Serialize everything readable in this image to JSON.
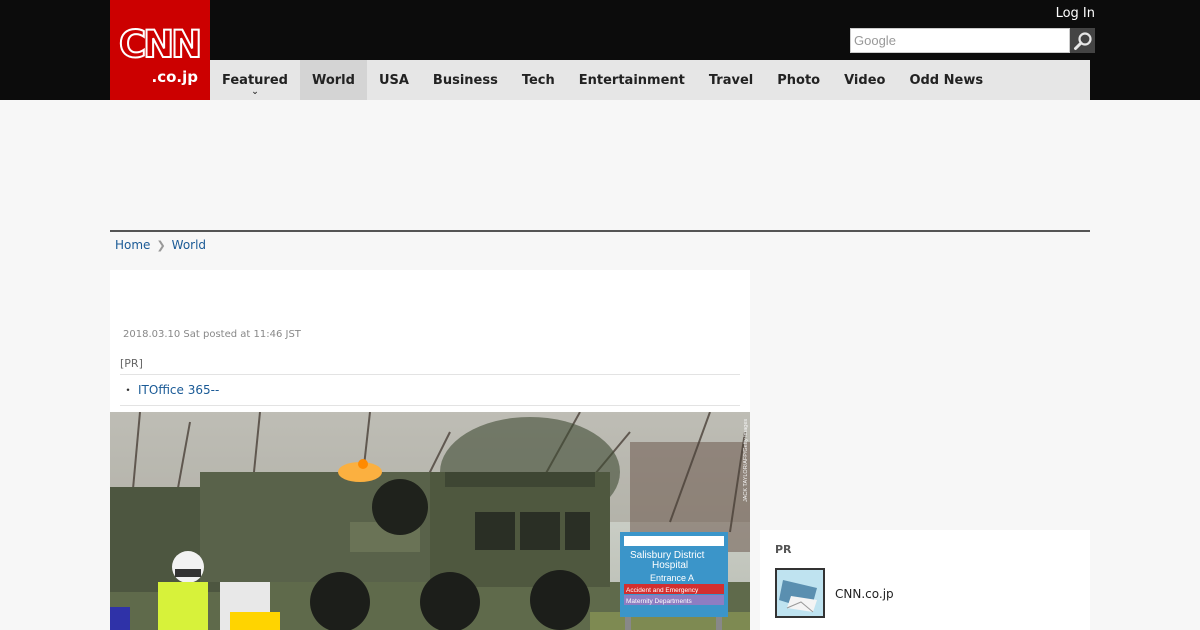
{
  "header": {
    "logo_main": "CNN",
    "logo_sub": ".co.jp",
    "login_label": "Log In",
    "search_placeholder": "Google"
  },
  "nav": {
    "items": [
      {
        "label": "Featured"
      },
      {
        "label": "World"
      },
      {
        "label": "USA"
      },
      {
        "label": "Business"
      },
      {
        "label": "Tech"
      },
      {
        "label": "Entertainment"
      },
      {
        "label": "Travel"
      },
      {
        "label": "Photo"
      },
      {
        "label": "Video"
      },
      {
        "label": "Odd News"
      }
    ],
    "active": "World"
  },
  "breadcrumb": {
    "home": "Home",
    "current": "World"
  },
  "article": {
    "posted": "2018.03.10 Sat posted at 11:46 JST",
    "pr_label": "[PR]",
    "pr_bullet": "・",
    "pr_link": "ITOffice 365--",
    "photo_sign_line1": "Salisbury District",
    "photo_sign_line2": "Hospital",
    "photo_sign_entrance": "Entrance A",
    "photo_sign_ae": "Accident and Emergency",
    "photo_sign_maternity": "Maternity Departments",
    "photo_credit": "JACK TAYLOR/AFP/Getty Images"
  },
  "sidebar": {
    "pr_label": "PR",
    "pr_item": "CNN.co.jp"
  },
  "colors": {
    "brand_red": "#cc0000",
    "topbar": "#0c0c0c",
    "link_blue": "#1a5a96"
  }
}
